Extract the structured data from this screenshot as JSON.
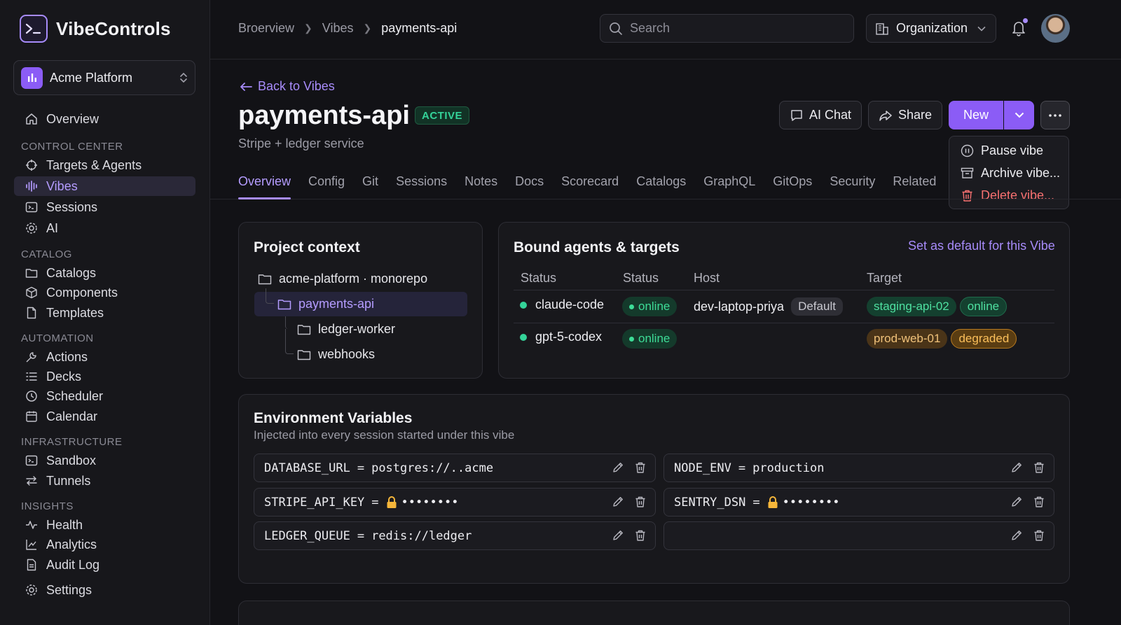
{
  "app": {
    "name": "VibeControls"
  },
  "workspace": {
    "name": "Acme Platform"
  },
  "sidebar": {
    "overview": "Overview",
    "sections": {
      "control_center": "CONTROL CENTER",
      "catalog": "CATALOG",
      "automation": "AUTOMATION",
      "infrastructure": "INFRASTRUCTURE",
      "insights": "INSIGHTS"
    },
    "items": {
      "targets": "Targets & Agents",
      "vibes": "Vibes",
      "sessions": "Sessions",
      "ai": "AI",
      "catalogs": "Catalogs",
      "components": "Components",
      "templates": "Templates",
      "actions": "Actions",
      "decks": "Decks",
      "scheduler": "Scheduler",
      "calendar": "Calendar",
      "sandbox": "Sandbox",
      "tunnels": "Tunnels",
      "health": "Health",
      "analytics": "Analytics",
      "audit_log": "Audit Log"
    },
    "settings": "Settings"
  },
  "header": {
    "breadcrumbs": [
      "Broerview",
      "Vibes",
      "payments-api"
    ],
    "search_placeholder": "Search",
    "org_label": "Organization"
  },
  "page": {
    "back_label": "Back to Vibes",
    "title": "payments-api",
    "status_badge": "ACTIVE",
    "subtitle": "Stripe + ledger service",
    "actions": {
      "ai_chat": "AI Chat",
      "share": "Share",
      "new": "New"
    },
    "menu": {
      "pause": "Pause vibe",
      "archive": "Archive vibe...",
      "delete": "Delete vibe..."
    },
    "tabs": [
      "Overview",
      "Config",
      "Git",
      "Sessions",
      "Notes",
      "Docs",
      "Scorecard",
      "Catalogs",
      "GraphQL",
      "GitOps",
      "Security",
      "Related"
    ],
    "active_tab": "Overview"
  },
  "project_context": {
    "title": "Project context",
    "root": "acme-platform · monorepo",
    "selected": "payments-api",
    "children": [
      "ledger-worker",
      "webhooks"
    ]
  },
  "bound": {
    "title": "Bound agents & targets",
    "set_default": "Set as default for this Vibe",
    "columns": [
      "Status",
      "Status",
      "Host",
      "Target"
    ],
    "rows": [
      {
        "agent": "claude-code",
        "status": "online",
        "host": "dev-laptop-priya",
        "host_badge": "Default",
        "target": "staging-api-02",
        "target_status": "online"
      },
      {
        "agent": "gpt-5-codex",
        "status": "online",
        "host": "",
        "host_badge": "",
        "target": "prod-web-01",
        "target_status": "degraded"
      }
    ]
  },
  "env": {
    "title": "Environment Variables",
    "subtitle": "Injected into every session started under this vibe",
    "vars": [
      {
        "key": "DATABASE_URL",
        "eq": "=",
        "value": "postgres://..acme"
      },
      {
        "key": "NODE_ENV",
        "eq": "=",
        "value": "production"
      },
      {
        "key": "STRIPE_API_KEY",
        "eq": "=",
        "value": "••••••••"
      },
      {
        "key": "SENTRY_DSN",
        "eq": "=",
        "value": "••••••••"
      },
      {
        "key": "LEDGER_QUEUE",
        "eq": "=",
        "value": "redis://ledger"
      },
      {
        "key": "",
        "eq": "",
        "value": ""
      }
    ]
  },
  "colors": {
    "accent": "#8b5cf6",
    "online": "#34d399",
    "degraded": "#fbbf5a",
    "danger": "#f87171"
  }
}
